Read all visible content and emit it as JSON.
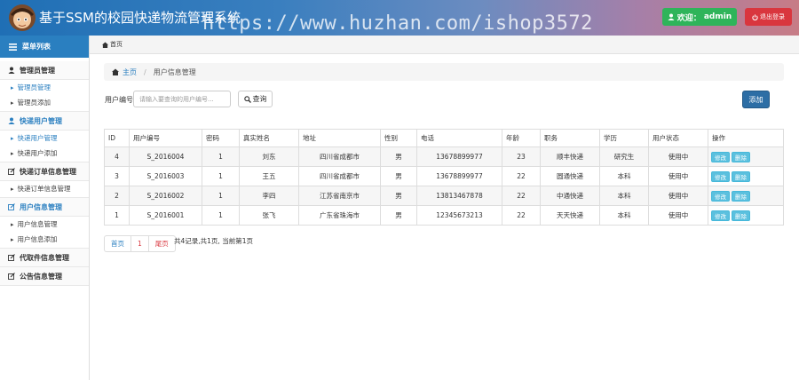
{
  "header": {
    "title": "基于SSM的校园快递物流管理系统",
    "watermark": "https://www.huzhan.com/ishop3572",
    "welcome_label": "欢迎：",
    "welcome_user": "admin",
    "logout_label": "退出登录"
  },
  "sidebar": {
    "menu_title": "菜单列表",
    "groups": [
      {
        "title": "管理员管理",
        "items": [
          "管理员管理",
          "管理员添加"
        ]
      },
      {
        "title": "快递用户管理",
        "items": [
          "快递用户管理",
          "快递用户添加"
        ]
      },
      {
        "title": "快递订单信息管理",
        "items": [
          "快递订单信息管理"
        ]
      },
      {
        "title": "用户信息管理",
        "items": [
          "用户信息管理",
          "用户信息添加"
        ]
      },
      {
        "title": "代取件信息管理",
        "items": []
      },
      {
        "title": "公告信息管理",
        "items": []
      }
    ]
  },
  "topnav": {
    "home": "首页"
  },
  "breadcrumb": {
    "home": "主页",
    "sep": "/",
    "current": "用户信息管理"
  },
  "search": {
    "label": "用户编号",
    "placeholder": "请输入要查询的用户编号...",
    "button": "查询"
  },
  "add_button": "添加",
  "table": {
    "headers": [
      "ID",
      "用户编号",
      "密码",
      "真实姓名",
      "地址",
      "性别",
      "电话",
      "年龄",
      "职务",
      "学历",
      "用户状态",
      "操作"
    ],
    "rows": [
      [
        "4",
        "S_2016004",
        "1",
        "刘东",
        "四川省成都市",
        "男",
        "13678899977",
        "23",
        "顺丰快递",
        "研究生",
        "使用中"
      ],
      [
        "3",
        "S_2016003",
        "1",
        "王五",
        "四川省成都市",
        "男",
        "13678899977",
        "22",
        "圆通快递",
        "本科",
        "使用中"
      ],
      [
        "2",
        "S_2016002",
        "1",
        "李四",
        "江苏省南京市",
        "男",
        "13813467878",
        "22",
        "中通快递",
        "本科",
        "使用中"
      ],
      [
        "1",
        "S_2016001",
        "1",
        "张飞",
        "广东省珠海市",
        "男",
        "12345673213",
        "22",
        "天天快递",
        "本科",
        "使用中"
      ]
    ],
    "edit_label": "修改",
    "delete_label": "删除"
  },
  "pager": {
    "first": "首页",
    "current": "1",
    "last": "尾页",
    "info": "共4记录,共1页, 当前第1页"
  },
  "colors": {
    "accent": "#2a7fc0",
    "success": "#2fb45a",
    "danger": "#d9363e",
    "info": "#5bc0de"
  }
}
